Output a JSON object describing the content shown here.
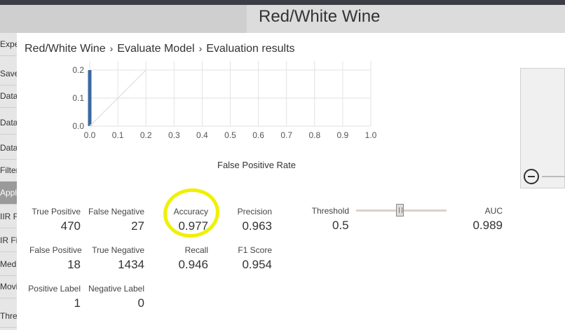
{
  "background": {
    "experiment_title": "Red/White Wine",
    "left_panel_items": [
      "Experi",
      "Saved",
      "Data I",
      "Data I",
      "Data T",
      "Filter",
      "Apply",
      "IIR Fi",
      "IR Fi",
      "Medi",
      "Movi",
      "Thres"
    ]
  },
  "breadcrumb": {
    "items": [
      "Red/White Wine",
      "Evaluate Model",
      "Evaluation results"
    ],
    "separator": "›"
  },
  "roc_chart": {
    "xlabel": "False Positive Rate",
    "x_ticks": [
      "0.0",
      "0.1",
      "0.2",
      "0.3",
      "0.4",
      "0.5",
      "0.6",
      "0.7",
      "0.8",
      "0.9",
      "1.0"
    ],
    "y_ticks": [
      "0.2",
      "0.1",
      "0.0"
    ]
  },
  "chart_data": {
    "type": "line",
    "xlabel": "False Positive Rate",
    "xlim": [
      0,
      1
    ],
    "ylim_visible": [
      0,
      0.2
    ],
    "series": [
      {
        "x": [
          0,
          0
        ],
        "y": [
          0,
          0.2
        ],
        "color": "#3b6aa0"
      },
      {
        "x": [
          0,
          0.2
        ],
        "y": [
          0,
          0.2
        ],
        "color": "#e4e4e4"
      }
    ]
  },
  "metrics": {
    "true_positive": {
      "label": "True Positive",
      "value": "470"
    },
    "false_negative": {
      "label": "False Negative",
      "value": "27"
    },
    "accuracy": {
      "label": "Accuracy",
      "value": "0.977"
    },
    "precision": {
      "label": "Precision",
      "value": "0.963"
    },
    "false_positive": {
      "label": "False Positive",
      "value": "18"
    },
    "true_negative": {
      "label": "True Negative",
      "value": "1434"
    },
    "recall": {
      "label": "Recall",
      "value": "0.946"
    },
    "f1_score": {
      "label": "F1 Score",
      "value": "0.954"
    },
    "positive_label": {
      "label": "Positive Label",
      "value": "1"
    },
    "negative_label": {
      "label": "Negative Label",
      "value": "0"
    },
    "threshold": {
      "label": "Threshold",
      "value": "0.5"
    },
    "auc": {
      "label": "AUC",
      "value": "0.989"
    }
  },
  "colors": {
    "highlight": "#f0f000",
    "roc_line": "#3b6aa0"
  }
}
